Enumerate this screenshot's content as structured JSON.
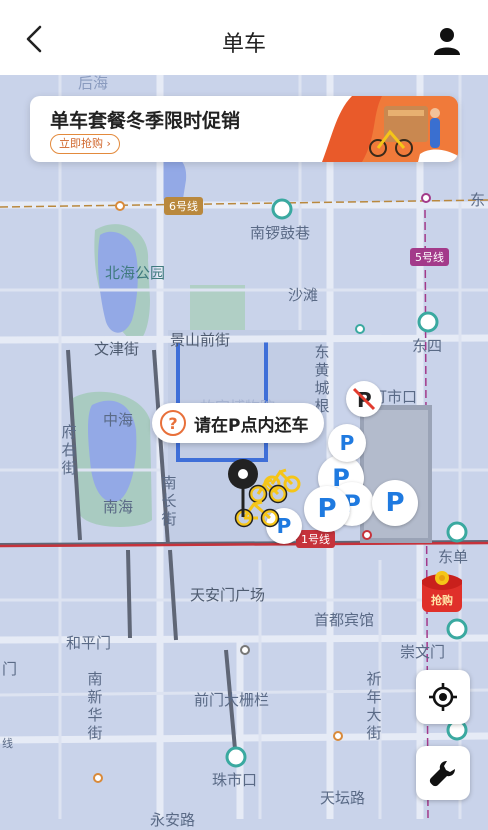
{
  "header": {
    "title": "单车"
  },
  "banner": {
    "title": "单车套餐冬季限时促销",
    "button": "立即抢购 ›"
  },
  "tooltip": {
    "icon": "?",
    "text": "请在P点内还车"
  },
  "map_labels": {
    "houhai": "后海",
    "line6": "6号线",
    "line5": "5号线",
    "line1": "1号线",
    "nanluoguxiang": "南锣鼓巷",
    "beihai_park": "北海公园",
    "shatan": "沙滩",
    "wenjinjie": "文津街",
    "jingshanqianjie": "景山前街",
    "donghuangchenggen": "东黄城根",
    "dongsi": "东四",
    "dengshikou": "灯市口",
    "zhonghai": "中海",
    "nanhai": "南海",
    "fuyoujie": "府右街",
    "nanchangjie": "南长街",
    "gugong": "故宫博物院",
    "tiananmen": "天安门广场",
    "dongdan": "东单",
    "shoudu_hotel": "首都宾馆",
    "chongwenmen": "崇文门",
    "hepingmen": "和平门",
    "nanxinhuajie": "南新华街",
    "qianmen": "前门大栅栏",
    "qiniandajie": "祈年大街",
    "zhushikou": "珠市口",
    "tiantanlu": "天坛路",
    "dongzhimen_short": "东",
    "xuanwumen_short": "门",
    "bottom_road": "永安路",
    "left_line": "线"
  },
  "markers": {
    "parking": "P",
    "redpacket_label": "抢购"
  },
  "icons": {
    "back": "chevron-left-icon",
    "user": "user-icon",
    "locate": "locate-icon",
    "wrench": "wrench-icon",
    "pin": "location-pin-icon",
    "bike": "bike-icon"
  },
  "colors": {
    "map_bg": "#c9d3ea",
    "parking_blue": "#1f7ae0",
    "bike_yellow": "#f5c518",
    "tooltip_orange": "#e8703a",
    "line6": "#b9883d",
    "line5": "#a33a8a",
    "line1": "#c6323b"
  }
}
